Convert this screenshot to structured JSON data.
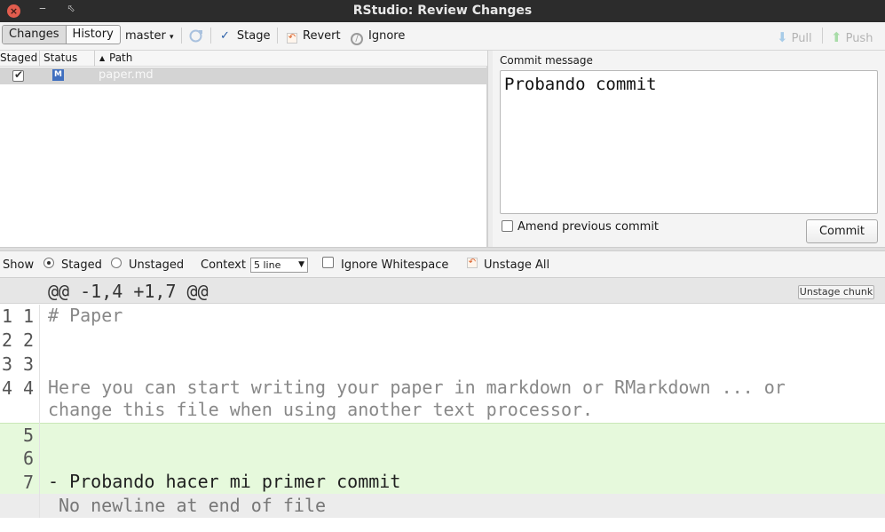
{
  "window": {
    "title": "RStudio: Review Changes"
  },
  "toolbar": {
    "tabs": [
      "Changes",
      "History"
    ],
    "branch": "master",
    "stage": "Stage",
    "revert": "Revert",
    "ignore": "Ignore",
    "pull": "Pull",
    "push": "Push"
  },
  "files": {
    "headers": {
      "staged": "Staged",
      "status": "Status",
      "path": "Path"
    },
    "rows": [
      {
        "staged": true,
        "status": "M",
        "path": "paper.md"
      }
    ]
  },
  "commit": {
    "label": "Commit message",
    "message": "Probando commit",
    "amend_label": "Amend previous commit",
    "button": "Commit"
  },
  "options": {
    "show_label": "Show",
    "staged": "Staged",
    "unstaged": "Unstaged",
    "selected": "Staged",
    "context_label": "Context",
    "context_value": "5 line",
    "ignore_ws": "Ignore Whitespace",
    "unstage_all": "Unstage All"
  },
  "diff": {
    "hunk_header": "@@ -1,4 +1,7 @@",
    "unstage_chunk": "Unstage chunk",
    "lines": [
      {
        "old": "1",
        "new": "1",
        "text": "# Paper",
        "type": "context"
      },
      {
        "old": "2",
        "new": "2",
        "text": "",
        "type": "context"
      },
      {
        "old": "3",
        "new": "3",
        "text": "",
        "type": "context"
      },
      {
        "old": "4",
        "new": "4",
        "text": "Here you can start writing your paper in markdown or RMarkdown ... or\nchange this file when using another text processor.",
        "type": "context"
      },
      {
        "old": "",
        "new": "5",
        "text": "",
        "type": "added"
      },
      {
        "old": "",
        "new": "6",
        "text": "",
        "type": "added"
      },
      {
        "old": "",
        "new": "7",
        "text": "- Probando hacer mi primer commit",
        "type": "added"
      }
    ],
    "no_newline": "No newline at end of file"
  },
  "colors": {
    "added_bg": "#e6f9dc",
    "titlebar_bg": "#2c2c2c",
    "status_modified": "#3f6fbf"
  }
}
